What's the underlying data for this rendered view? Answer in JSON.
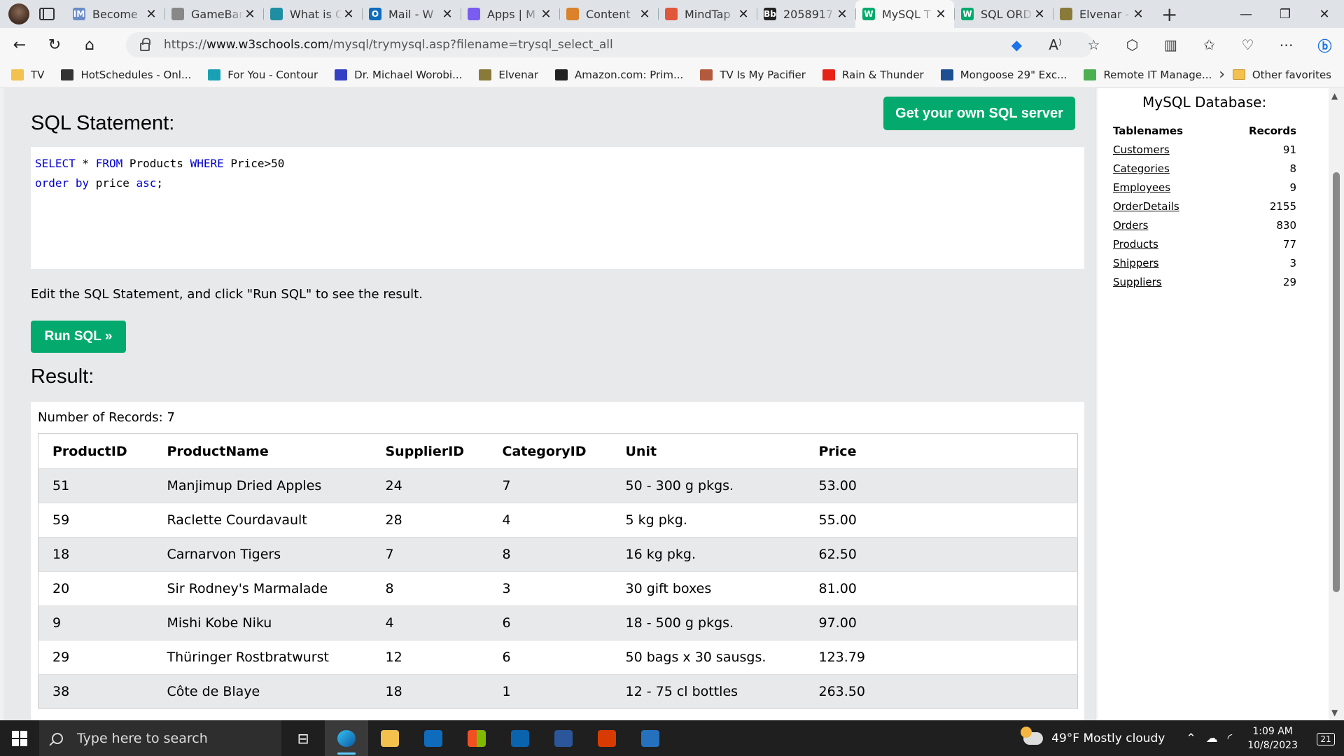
{
  "tabs": [
    {
      "label": "Become",
      "icon": "im-icon",
      "color": "#6b8cc7",
      "glyph": "IM"
    },
    {
      "label": "GameBar",
      "icon": "avatar-icon",
      "color": "#888888",
      "glyph": ""
    },
    {
      "label": "What is C",
      "icon": "eye-icon",
      "color": "#1f8ea3",
      "glyph": ""
    },
    {
      "label": "Mail - W",
      "icon": "outlook-icon",
      "color": "#0f6cbd",
      "glyph": "O"
    },
    {
      "label": "Apps | M",
      "icon": "apps-icon",
      "color": "#7a5cf0",
      "glyph": ""
    },
    {
      "label": "Content",
      "icon": "chart-icon",
      "color": "#d9822b",
      "glyph": ""
    },
    {
      "label": "MindTap",
      "icon": "mindtap-icon",
      "color": "#e0573c",
      "glyph": ""
    },
    {
      "label": "2058917",
      "icon": "blackboard-icon",
      "color": "#222222",
      "glyph": "Bb"
    },
    {
      "label": "MySQL T",
      "icon": "w3schools-icon",
      "color": "#04aa6d",
      "glyph": "W",
      "active": true
    },
    {
      "label": "SQL ORD",
      "icon": "w3schools-icon",
      "color": "#04aa6d",
      "glyph": "W"
    },
    {
      "label": "Elvenar -",
      "icon": "elvenar-icon",
      "color": "#8a7a3a",
      "glyph": ""
    }
  ],
  "window_controls": {
    "minimize": "—",
    "restore": "❐",
    "close": "✕"
  },
  "address": {
    "scheme": "https://",
    "host": "www.w3schools.com",
    "path": "/mysql/trymysql.asp?filename=trysql_select_all"
  },
  "favorites": [
    {
      "label": "TV",
      "icon": "folder-icon"
    },
    {
      "label": "HotSchedules - Onl...",
      "icon": "hotschedules-icon"
    },
    {
      "label": "For You - Contour",
      "icon": "contour-icon"
    },
    {
      "label": "Dr. Michael Worobi...",
      "icon": "heart-icon"
    },
    {
      "label": "Elvenar",
      "icon": "elvenar-icon"
    },
    {
      "label": "Amazon.com: Prim...",
      "icon": "amazon-icon"
    },
    {
      "label": "TV Is My Pacifier",
      "icon": "tvpacifier-icon"
    },
    {
      "label": "Rain & Thunder",
      "icon": "youtube-icon"
    },
    {
      "label": "Mongoose 29\" Exc...",
      "icon": "walmart-icon"
    },
    {
      "label": "Remote IT Manage...",
      "icon": "remote-icon"
    }
  ],
  "other_favorites": "Other favorites",
  "editor": {
    "heading": "SQL Statement:",
    "get_server_label": "Get your own SQL server",
    "line1": {
      "kw1": "SELECT",
      "star": " * ",
      "kw2": "FROM",
      "t1": " Products ",
      "kw3": "WHERE",
      "t2": " Price>50"
    },
    "line2": {
      "kw1": "order",
      "t1": " ",
      "kw2": "by",
      "t2": " price ",
      "kw3": "asc",
      "t3": ";"
    },
    "hint": "Edit the SQL Statement, and click \"Run SQL\" to see the result.",
    "run_label": "Run SQL »"
  },
  "result": {
    "heading": "Result:",
    "count": "Number of Records: 7",
    "columns": [
      "ProductID",
      "ProductName",
      "SupplierID",
      "CategoryID",
      "Unit",
      "Price"
    ],
    "rows": [
      [
        "51",
        "Manjimup Dried Apples",
        "24",
        "7",
        "50 - 300 g pkgs.",
        "53.00"
      ],
      [
        "59",
        "Raclette Courdavault",
        "28",
        "4",
        "5 kg pkg.",
        "55.00"
      ],
      [
        "18",
        "Carnarvon Tigers",
        "7",
        "8",
        "16 kg pkg.",
        "62.50"
      ],
      [
        "20",
        "Sir Rodney's Marmalade",
        "8",
        "3",
        "30 gift boxes",
        "81.00"
      ],
      [
        "9",
        "Mishi Kobe Niku",
        "4",
        "6",
        "18 - 500 g pkgs.",
        "97.00"
      ],
      [
        "29",
        "Thüringer Rostbratwurst",
        "12",
        "6",
        "50 bags x 30 sausgs.",
        "123.79"
      ],
      [
        "38",
        "Côte de Blaye",
        "18",
        "1",
        "12 - 75 cl bottles",
        "263.50"
      ]
    ]
  },
  "database": {
    "heading": "MySQL Database:",
    "col_name": "Tablenames",
    "col_records": "Records",
    "tables": [
      {
        "name": "Customers",
        "records": "91"
      },
      {
        "name": "Categories",
        "records": "8"
      },
      {
        "name": "Employees",
        "records": "9"
      },
      {
        "name": "OrderDetails",
        "records": "2155"
      },
      {
        "name": "Orders",
        "records": "830"
      },
      {
        "name": "Products",
        "records": "77"
      },
      {
        "name": "Shippers",
        "records": "3"
      },
      {
        "name": "Suppliers",
        "records": "29"
      }
    ]
  },
  "taskbar": {
    "search_placeholder": "Type here to search",
    "weather": "49°F  Mostly cloudy",
    "time": "1:09 AM",
    "date": "10/8/2023",
    "notifications": "21"
  }
}
